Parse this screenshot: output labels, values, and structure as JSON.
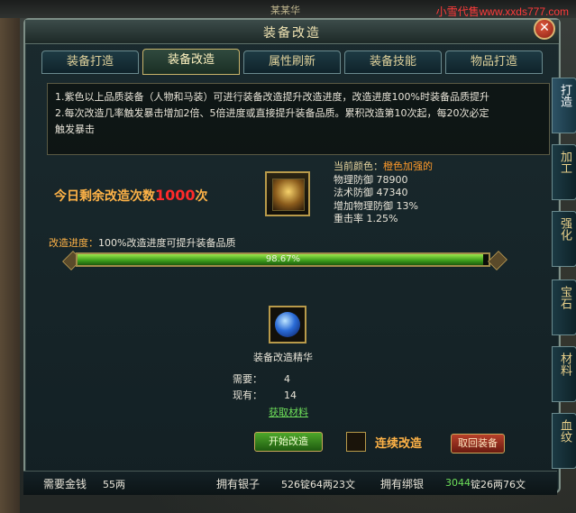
{
  "topbar": {
    "site": "小雪代售www.xxds777.com",
    "name": "某某华"
  },
  "window": {
    "title": "装备改造",
    "close": "✕"
  },
  "tabs": [
    {
      "label": "装备打造"
    },
    {
      "label": "装备改造",
      "active": true
    },
    {
      "label": "属性刷新"
    },
    {
      "label": "装备技能"
    },
    {
      "label": "物品打造"
    }
  ],
  "side_tabs": [
    {
      "label": "打造",
      "active": true
    },
    {
      "label": "加工"
    },
    {
      "label": "强化"
    },
    {
      "label": "宝石"
    },
    {
      "label": "材料"
    },
    {
      "label": "血纹"
    }
  ],
  "description": [
    "1.紫色以上品质装备（人物和马装）可进行装备改造提升改造进度，改造进度100%时装备品质提升",
    "2.每次改造几率触发暴击增加2倍、5倍进度或直接提升装备品质。累积改造第10次起，每20次必定",
    "触发暴击"
  ],
  "remaining": {
    "prefix": "今日剩余改造次数",
    "count": "1000",
    "suffix": "次"
  },
  "item_stats": {
    "current_color_label": "当前颜色：",
    "current_color_value": "橙色加强的",
    "lines": [
      "物理防御 78900",
      "法术防御 47340",
      "增加物理防御 13%",
      "重击率  1.25%"
    ]
  },
  "progress": {
    "label": "改造进度：",
    "hint": "100%改造进度可提升装备品质",
    "value_text": "98.67%",
    "value": 98.67
  },
  "material": {
    "name": "装备改造精华",
    "need_label": "需要：",
    "need_value": "4",
    "have_label": "现有：",
    "have_value": "14",
    "obtain": "获取材料"
  },
  "actions": {
    "start": "开始改造",
    "continuous": "连续改造",
    "back": "取回装备"
  },
  "bottom": {
    "gold_label": "需要金钱",
    "gold_value": "55两",
    "silver_label": "拥有银子",
    "silver_value": "526锭64两23文",
    "bound_label": "拥有绑银",
    "bound_value_green": "3044",
    "bound_value_rest": "锭26两76文"
  },
  "colors": {
    "accent_orange": "#ffb347",
    "count_red": "#ff2a2a",
    "bar_green": "#3a9a1a",
    "link_green": "#6ee05a"
  }
}
